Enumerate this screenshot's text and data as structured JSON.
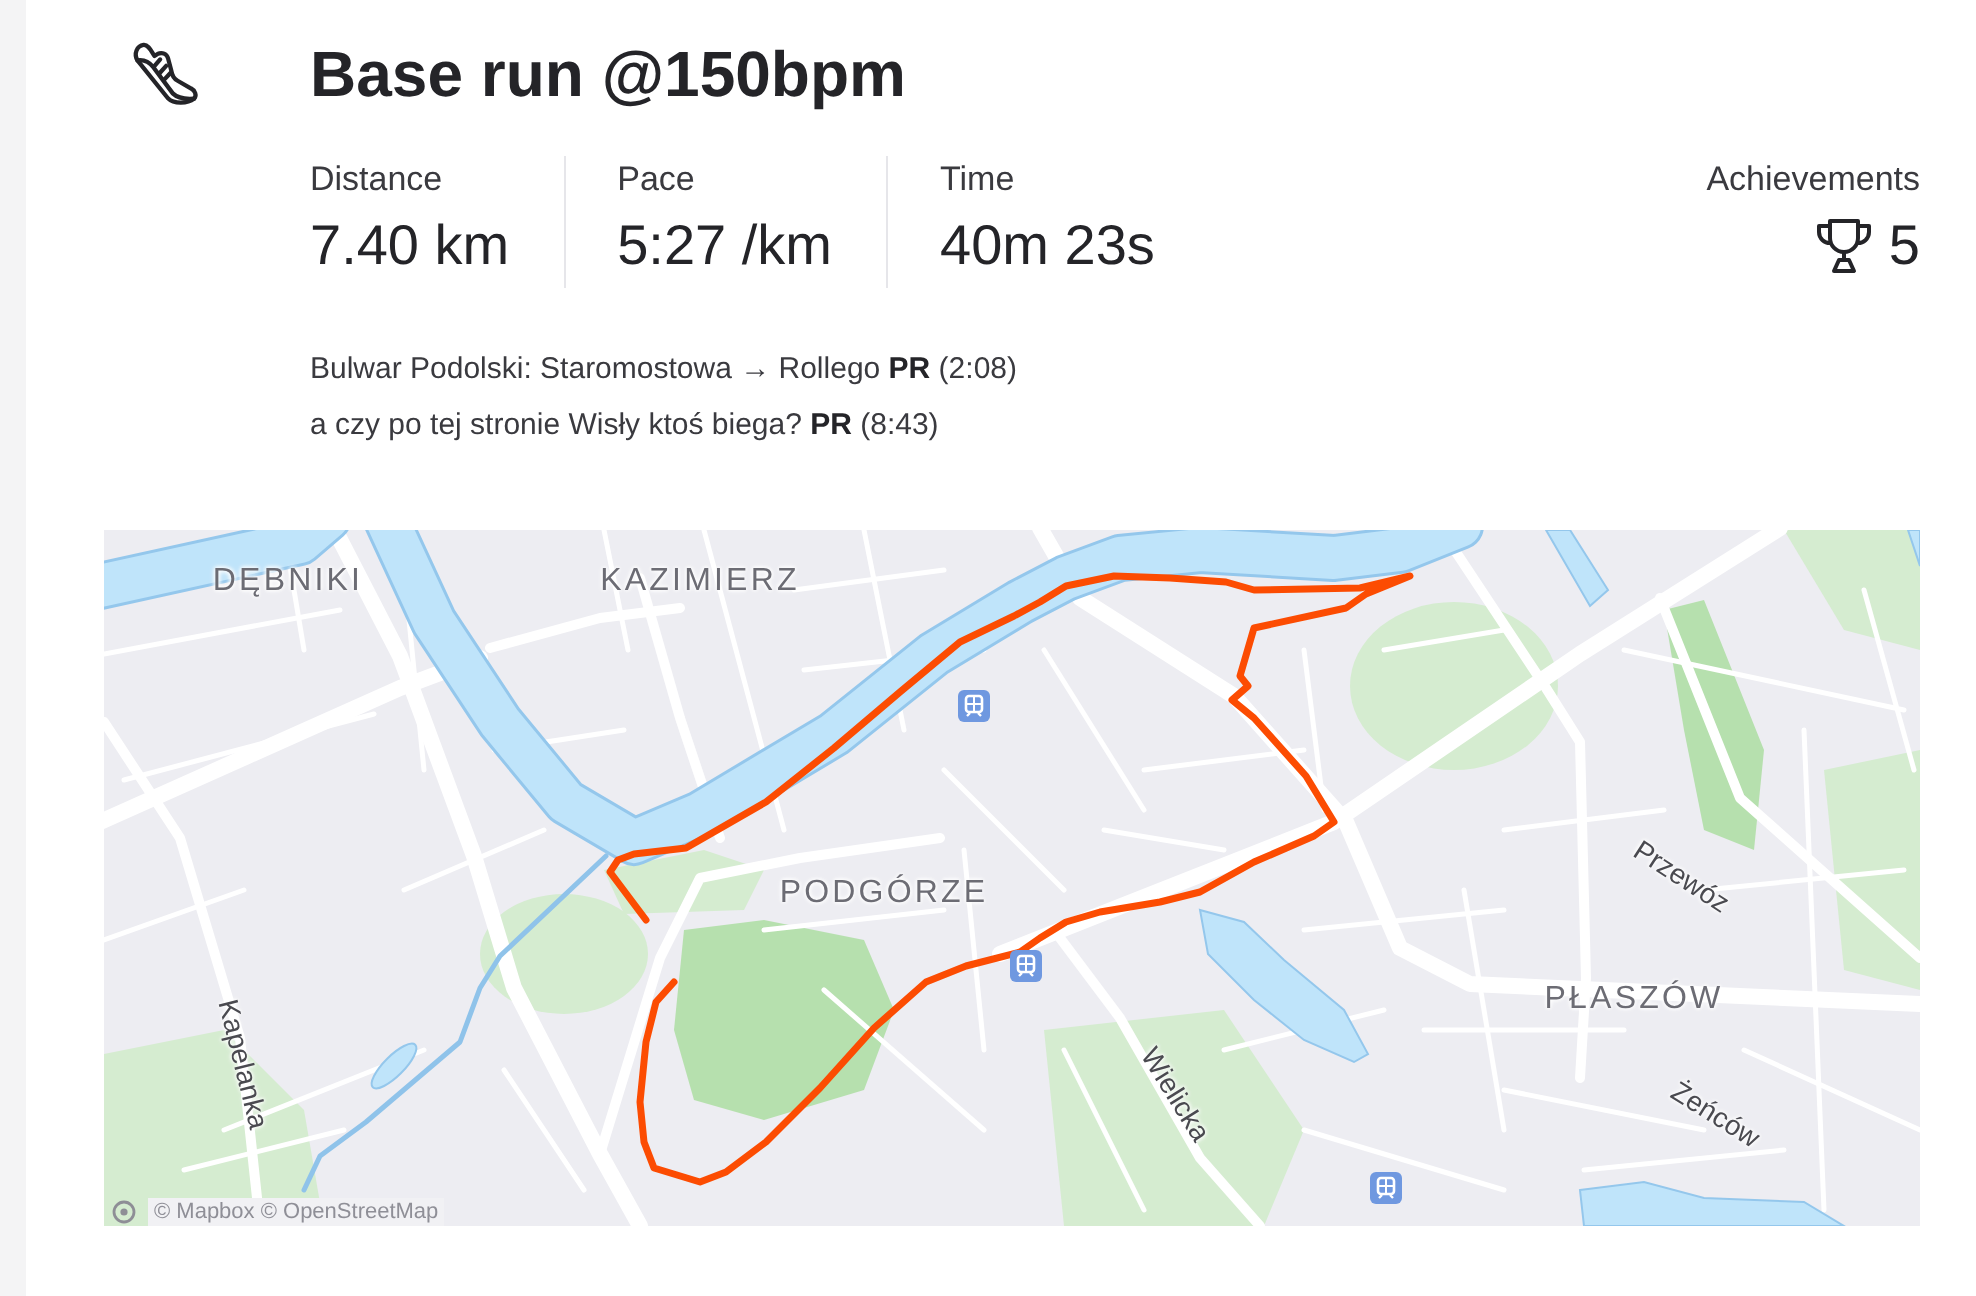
{
  "activity": {
    "title": "Base run @150bpm"
  },
  "stats": [
    {
      "label": "Distance",
      "value": "7.40 km"
    },
    {
      "label": "Pace",
      "value": "5:27 /km"
    },
    {
      "label": "Time",
      "value": "40m 23s"
    }
  ],
  "achievements": {
    "label": "Achievements",
    "count": "5"
  },
  "segments": [
    {
      "text": "Bulwar Podolski: Staromostowa → Rollego **PR** (2:08)"
    },
    {
      "text": "a czy po tej stronie Wisły ktoś biega? **PR** (8:43)"
    }
  ],
  "map": {
    "labels": [
      {
        "text": "DĘBNIKI",
        "kind": "district"
      },
      {
        "text": "KAZIMIERZ",
        "kind": "district"
      },
      {
        "text": "PODGÓRZE",
        "kind": "district"
      },
      {
        "text": "Przewóz",
        "kind": "locality"
      },
      {
        "text": "PŁASZÓW",
        "kind": "district"
      },
      {
        "text": "Kapelanka",
        "kind": "street"
      },
      {
        "text": "Wielicka",
        "kind": "street"
      },
      {
        "text": "Żeńców",
        "kind": "locality"
      }
    ],
    "attribution": "© Mapbox © OpenStreetMap"
  }
}
